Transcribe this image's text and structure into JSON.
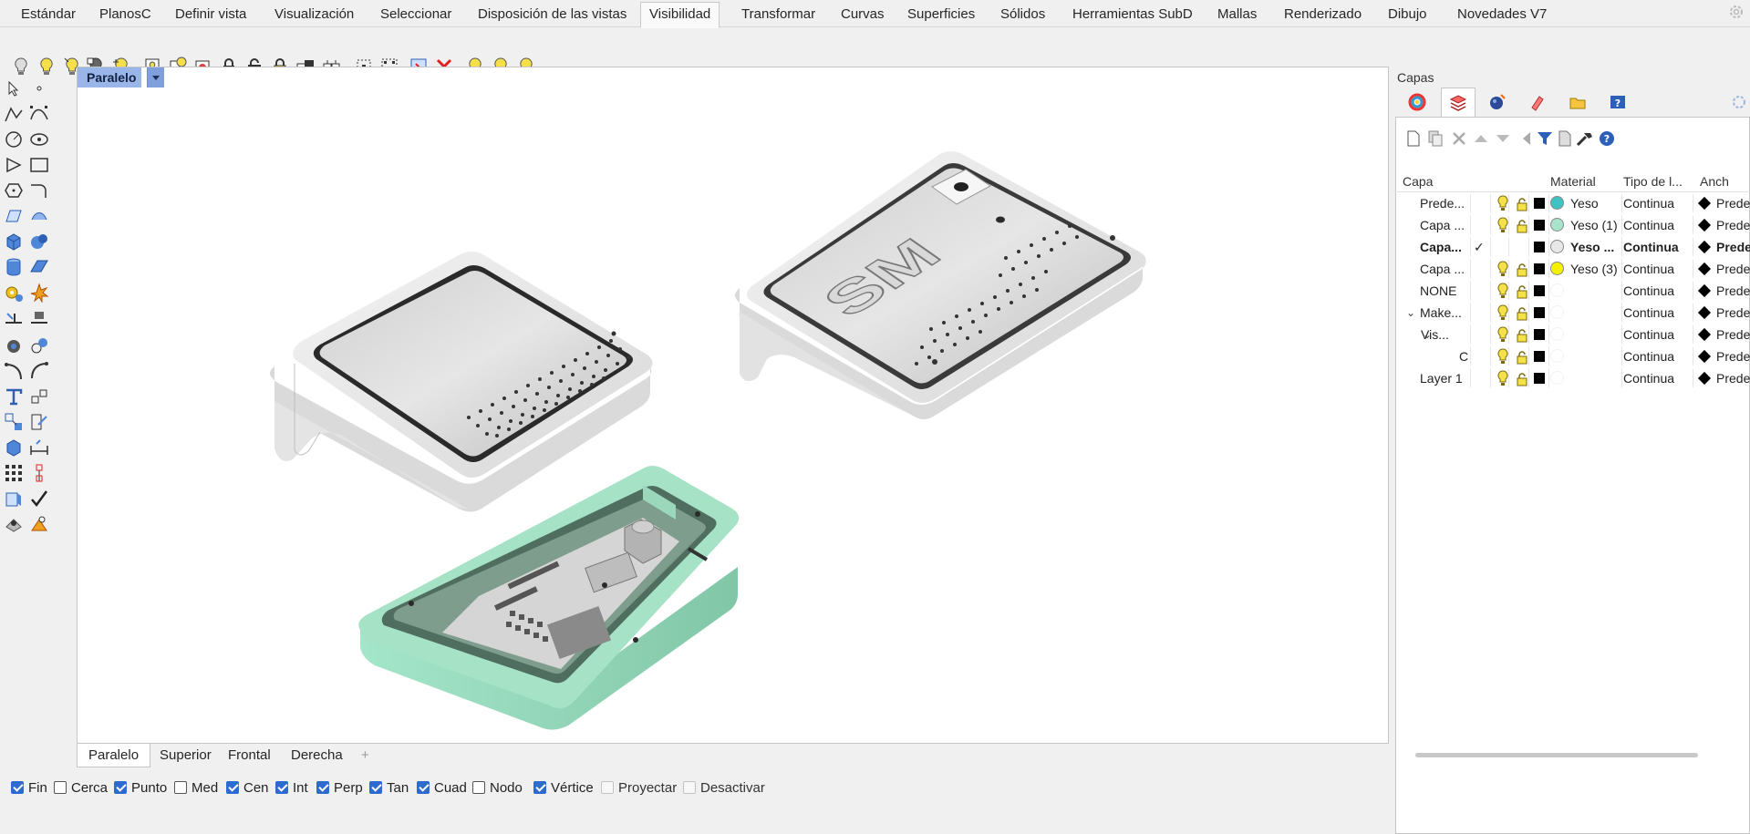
{
  "menu": {
    "tabs": [
      "Estándar",
      "PlanosC",
      "Definir vista",
      "Visualización",
      "Seleccionar",
      "Disposición de las vistas",
      "Visibilidad",
      "Transformar",
      "Curvas",
      "Superficies",
      "Sólidos",
      "Herramientas SubD",
      "Mallas",
      "Renderizado",
      "Dibujo",
      "Novedades V7"
    ],
    "active": "Visibilidad"
  },
  "viewport": {
    "label": "Paralelo",
    "tabs": [
      "Paralelo",
      "Superior",
      "Frontal",
      "Derecha"
    ],
    "active_tab": "Paralelo",
    "add_tab": "+",
    "colors": {
      "enclosure": "#9fdcc0",
      "lid": "#d9d9d9",
      "viewport_label_bg": "#9ab6e8"
    }
  },
  "osnaps": [
    {
      "label": "Fin",
      "checked": true
    },
    {
      "label": "Cerca",
      "checked": false
    },
    {
      "label": "Punto",
      "checked": true
    },
    {
      "label": "Med",
      "checked": false
    },
    {
      "label": "Cen",
      "checked": true
    },
    {
      "label": "Int",
      "checked": true
    },
    {
      "label": "Perp",
      "checked": true
    },
    {
      "label": "Tan",
      "checked": true
    },
    {
      "label": "Cuad",
      "checked": true
    },
    {
      "label": "Nodo",
      "checked": false
    },
    {
      "label": "Vértice",
      "checked": true
    },
    {
      "label": "Proyectar",
      "checked": false,
      "disabled": true
    },
    {
      "label": "Desactivar",
      "checked": false,
      "disabled": true
    }
  ],
  "layers_panel": {
    "title": "Capas",
    "columns": {
      "name": "Capa",
      "material": "Material",
      "linetype": "Tipo de l...",
      "width": "Anch"
    },
    "rows": [
      {
        "name": "Prede...",
        "current": "",
        "material": "Yeso",
        "mat_color": "#3fc2c2",
        "linetype": "Continua",
        "width": "Prede"
      },
      {
        "name": "Capa ...",
        "current": "",
        "material": "Yeso (1)",
        "mat_color": "#a8e3cc",
        "linetype": "Continua",
        "width": "Prede"
      },
      {
        "name": "Capa...",
        "current": "✓",
        "material": "Yeso ...",
        "mat_color": "#e8e8e8",
        "linetype": "Continua",
        "width": "Prede",
        "bold": true
      },
      {
        "name": "Capa ...",
        "current": "",
        "material": "Yeso (3)",
        "mat_color": "#f5f000",
        "linetype": "Continua",
        "width": "Prede"
      },
      {
        "name": "NONE",
        "current": "",
        "material": "",
        "mat_color": "",
        "linetype": "Continua",
        "width": "Prede"
      },
      {
        "name": "Make...",
        "current": "",
        "material": "",
        "mat_color": "",
        "linetype": "Continua",
        "width": "Prede",
        "expander": "v"
      },
      {
        "name": "Vis...",
        "current": "",
        "material": "",
        "mat_color": "",
        "linetype": "Continua",
        "width": "Prede",
        "expander": "v"
      },
      {
        "name": "C",
        "current": "",
        "material": "",
        "mat_color": "",
        "linetype": "Continua",
        "width": "Prede"
      },
      {
        "name": "Layer 1",
        "current": "",
        "material": "",
        "mat_color": "",
        "linetype": "Continua",
        "width": "Prede"
      }
    ]
  }
}
